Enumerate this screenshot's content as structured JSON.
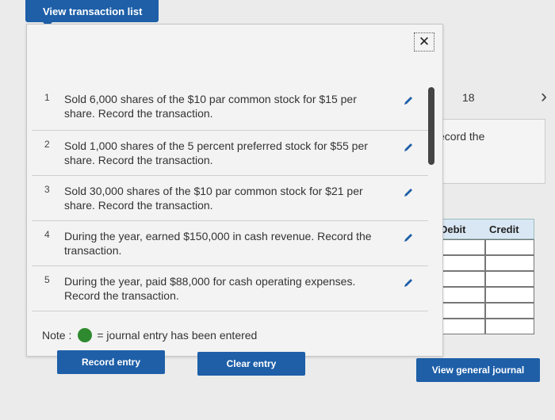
{
  "header": {
    "view_list_label": "View transaction list"
  },
  "background": {
    "number": "18",
    "partial_text": "ecord the",
    "ledger_cols": [
      "Debit",
      "Credit"
    ]
  },
  "popup": {
    "close_symbol": "✕",
    "items": [
      {
        "num": "1",
        "text": "Sold 6,000 shares of the $10 par common stock for $15 per share. Record the transaction."
      },
      {
        "num": "2",
        "text": "Sold 1,000 shares of the 5 percent preferred stock for $55 per share. Record the transaction."
      },
      {
        "num": "3",
        "text": "Sold 30,000 shares of the $10 par common stock for $21 per share. Record the transaction."
      },
      {
        "num": "4",
        "text": "During the year, earned $150,000 in cash revenue. Record the transaction."
      },
      {
        "num": "5",
        "text": "During the year, paid $88,000 for cash operating expenses. Record the transaction."
      }
    ],
    "note_prefix": "Note :",
    "note_suffix": "= journal entry has been entered",
    "record_label": "Record entry",
    "clear_label": "Clear entry"
  },
  "footer": {
    "view_gj_label": "View general journal"
  },
  "colors": {
    "accent": "#1e5fa8",
    "note_dot": "#2f8a2f"
  }
}
